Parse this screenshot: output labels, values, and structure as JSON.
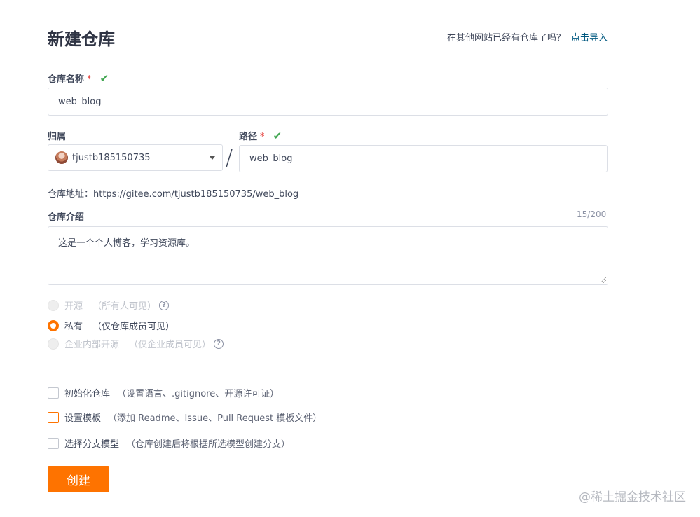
{
  "header": {
    "title": "新建仓库",
    "import_hint": "在其他网站已经有仓库了吗？",
    "import_link": "点击导入"
  },
  "repo_name": {
    "label": "仓库名称",
    "required": "*",
    "value": "web_blog"
  },
  "owner": {
    "label": "归属",
    "value": "tjustb185150735"
  },
  "path": {
    "label": "路径",
    "required": "*",
    "separator": "/",
    "value": "web_blog"
  },
  "repo_url": {
    "text": "仓库地址：https://gitee.com/tjustb185150735/web_blog"
  },
  "description": {
    "label": "仓库介绍",
    "counter": "15/200",
    "value": "这是一个个人博客，学习资源库。"
  },
  "visibility": {
    "options": [
      {
        "label": "开源",
        "desc": "（所有人可见）",
        "state": "disabled",
        "has_help": true
      },
      {
        "label": "私有",
        "desc": "（仅仓库成员可见）",
        "state": "checked",
        "has_help": false
      },
      {
        "label": "企业内部开源",
        "desc": "（仅企业成员可见）",
        "state": "disabled",
        "has_help": true
      }
    ]
  },
  "options": {
    "items": [
      {
        "label": "初始化仓库",
        "desc": "（设置语言、.gitignore、开源许可证）",
        "checked": false,
        "focused": false
      },
      {
        "label": "设置模板",
        "desc": "（添加 Readme、Issue、Pull Request 模板文件）",
        "checked": false,
        "focused": true
      },
      {
        "label": "选择分支模型",
        "desc": "（仓库创建后将根据所选模型创建分支）",
        "checked": false,
        "focused": false
      }
    ]
  },
  "actions": {
    "create_label": "创建"
  },
  "watermark": {
    "text": "@稀土掘金技术社区"
  },
  "colors": {
    "accent": "#fe7300",
    "link": "#005980",
    "valid": "#3fa54f",
    "required": "#e53935"
  },
  "icons": {
    "valid": "check-icon",
    "help": "question-circle-icon",
    "dropdown": "caret-down-icon"
  }
}
